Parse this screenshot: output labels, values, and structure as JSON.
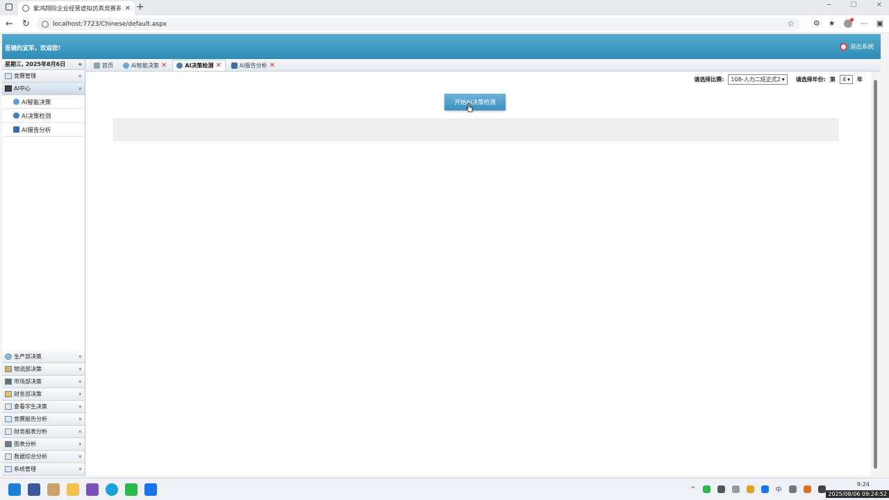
{
  "browser": {
    "tab_title": "紫鸿翔际企业经营虚拟仿真竞赛系",
    "tab_close": "✕",
    "new_tab": "+",
    "url": "localhost:7723/Chinese/default.aspx",
    "window_controls": [
      "─",
      "☐",
      "✕"
    ]
  },
  "header": {
    "welcome": "吾骑的宜军，欢迎您!",
    "logout": "退出系统"
  },
  "sidebar": {
    "date": "星期三, 2025年8月6日",
    "collapse_glyph": "«",
    "top_groups": [
      {
        "label": "竞赛管理",
        "chev": "»"
      },
      {
        "label": "AI中心",
        "chev": "«"
      }
    ],
    "ai_items": [
      {
        "label": "AI智能决策"
      },
      {
        "label": "AI决策检测"
      },
      {
        "label": "AI报告分析"
      }
    ],
    "bottom_groups": [
      {
        "label": "生产部决策"
      },
      {
        "label": "物流部决策"
      },
      {
        "label": "市场部决策"
      },
      {
        "label": "财务部决策"
      },
      {
        "label": "查看学生决策"
      },
      {
        "label": "竞赛报告分析"
      },
      {
        "label": "财务报表分析"
      },
      {
        "label": "图表分析"
      },
      {
        "label": "数据综合分析"
      },
      {
        "label": "系统管理"
      }
    ]
  },
  "content_tabs": [
    {
      "label": "首页",
      "closable": false,
      "active": false
    },
    {
      "label": "AI智能决策",
      "closable": true,
      "active": false
    },
    {
      "label": "AI决策检测",
      "closable": true,
      "active": true
    },
    {
      "label": "AI报告分析",
      "closable": true,
      "active": false
    }
  ],
  "filters": {
    "match_label": "请选择比赛:",
    "match_value": "108-人力二班正式2",
    "year_label": "请选择年份:",
    "year_prefix": "第",
    "year_value": "4",
    "year_suffix": "年"
  },
  "main": {
    "start_button": "开始AI决策检测"
  },
  "taskbar": {
    "time": "9:24",
    "date_overlay": "2025/08/06 09:24:52"
  }
}
